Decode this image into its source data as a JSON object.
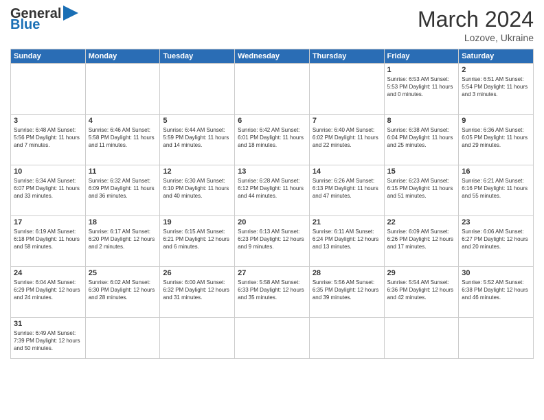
{
  "header": {
    "logo_general": "General",
    "logo_blue": "Blue",
    "month_title": "March 2024",
    "location": "Lozove, Ukraine"
  },
  "weekdays": [
    "Sunday",
    "Monday",
    "Tuesday",
    "Wednesday",
    "Thursday",
    "Friday",
    "Saturday"
  ],
  "weeks": [
    [
      {
        "day": "",
        "info": ""
      },
      {
        "day": "",
        "info": ""
      },
      {
        "day": "",
        "info": ""
      },
      {
        "day": "",
        "info": ""
      },
      {
        "day": "",
        "info": ""
      },
      {
        "day": "1",
        "info": "Sunrise: 6:53 AM\nSunset: 5:53 PM\nDaylight: 11 hours\nand 0 minutes."
      },
      {
        "day": "2",
        "info": "Sunrise: 6:51 AM\nSunset: 5:54 PM\nDaylight: 11 hours\nand 3 minutes."
      }
    ],
    [
      {
        "day": "3",
        "info": "Sunrise: 6:48 AM\nSunset: 5:56 PM\nDaylight: 11 hours\nand 7 minutes."
      },
      {
        "day": "4",
        "info": "Sunrise: 6:46 AM\nSunset: 5:58 PM\nDaylight: 11 hours\nand 11 minutes."
      },
      {
        "day": "5",
        "info": "Sunrise: 6:44 AM\nSunset: 5:59 PM\nDaylight: 11 hours\nand 14 minutes."
      },
      {
        "day": "6",
        "info": "Sunrise: 6:42 AM\nSunset: 6:01 PM\nDaylight: 11 hours\nand 18 minutes."
      },
      {
        "day": "7",
        "info": "Sunrise: 6:40 AM\nSunset: 6:02 PM\nDaylight: 11 hours\nand 22 minutes."
      },
      {
        "day": "8",
        "info": "Sunrise: 6:38 AM\nSunset: 6:04 PM\nDaylight: 11 hours\nand 25 minutes."
      },
      {
        "day": "9",
        "info": "Sunrise: 6:36 AM\nSunset: 6:05 PM\nDaylight: 11 hours\nand 29 minutes."
      }
    ],
    [
      {
        "day": "10",
        "info": "Sunrise: 6:34 AM\nSunset: 6:07 PM\nDaylight: 11 hours\nand 33 minutes."
      },
      {
        "day": "11",
        "info": "Sunrise: 6:32 AM\nSunset: 6:09 PM\nDaylight: 11 hours\nand 36 minutes."
      },
      {
        "day": "12",
        "info": "Sunrise: 6:30 AM\nSunset: 6:10 PM\nDaylight: 11 hours\nand 40 minutes."
      },
      {
        "day": "13",
        "info": "Sunrise: 6:28 AM\nSunset: 6:12 PM\nDaylight: 11 hours\nand 44 minutes."
      },
      {
        "day": "14",
        "info": "Sunrise: 6:26 AM\nSunset: 6:13 PM\nDaylight: 11 hours\nand 47 minutes."
      },
      {
        "day": "15",
        "info": "Sunrise: 6:23 AM\nSunset: 6:15 PM\nDaylight: 11 hours\nand 51 minutes."
      },
      {
        "day": "16",
        "info": "Sunrise: 6:21 AM\nSunset: 6:16 PM\nDaylight: 11 hours\nand 55 minutes."
      }
    ],
    [
      {
        "day": "17",
        "info": "Sunrise: 6:19 AM\nSunset: 6:18 PM\nDaylight: 11 hours\nand 58 minutes."
      },
      {
        "day": "18",
        "info": "Sunrise: 6:17 AM\nSunset: 6:20 PM\nDaylight: 12 hours\nand 2 minutes."
      },
      {
        "day": "19",
        "info": "Sunrise: 6:15 AM\nSunset: 6:21 PM\nDaylight: 12 hours\nand 6 minutes."
      },
      {
        "day": "20",
        "info": "Sunrise: 6:13 AM\nSunset: 6:23 PM\nDaylight: 12 hours\nand 9 minutes."
      },
      {
        "day": "21",
        "info": "Sunrise: 6:11 AM\nSunset: 6:24 PM\nDaylight: 12 hours\nand 13 minutes."
      },
      {
        "day": "22",
        "info": "Sunrise: 6:09 AM\nSunset: 6:26 PM\nDaylight: 12 hours\nand 17 minutes."
      },
      {
        "day": "23",
        "info": "Sunrise: 6:06 AM\nSunset: 6:27 PM\nDaylight: 12 hours\nand 20 minutes."
      }
    ],
    [
      {
        "day": "24",
        "info": "Sunrise: 6:04 AM\nSunset: 6:29 PM\nDaylight: 12 hours\nand 24 minutes."
      },
      {
        "day": "25",
        "info": "Sunrise: 6:02 AM\nSunset: 6:30 PM\nDaylight: 12 hours\nand 28 minutes."
      },
      {
        "day": "26",
        "info": "Sunrise: 6:00 AM\nSunset: 6:32 PM\nDaylight: 12 hours\nand 31 minutes."
      },
      {
        "day": "27",
        "info": "Sunrise: 5:58 AM\nSunset: 6:33 PM\nDaylight: 12 hours\nand 35 minutes."
      },
      {
        "day": "28",
        "info": "Sunrise: 5:56 AM\nSunset: 6:35 PM\nDaylight: 12 hours\nand 39 minutes."
      },
      {
        "day": "29",
        "info": "Sunrise: 5:54 AM\nSunset: 6:36 PM\nDaylight: 12 hours\nand 42 minutes."
      },
      {
        "day": "30",
        "info": "Sunrise: 5:52 AM\nSunset: 6:38 PM\nDaylight: 12 hours\nand 46 minutes."
      }
    ],
    [
      {
        "day": "31",
        "info": "Sunrise: 6:49 AM\nSunset: 7:39 PM\nDaylight: 12 hours\nand 50 minutes."
      },
      {
        "day": "",
        "info": ""
      },
      {
        "day": "",
        "info": ""
      },
      {
        "day": "",
        "info": ""
      },
      {
        "day": "",
        "info": ""
      },
      {
        "day": "",
        "info": ""
      },
      {
        "day": "",
        "info": ""
      }
    ]
  ]
}
